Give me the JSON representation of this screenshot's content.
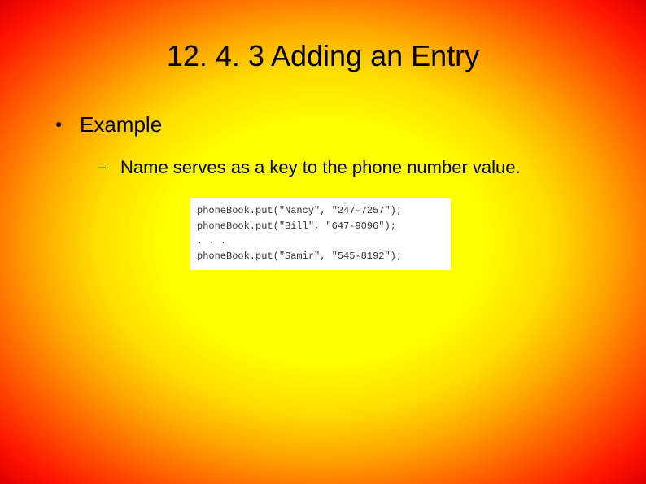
{
  "title": "12. 4. 3 Adding an Entry",
  "bullet": {
    "text": "Example",
    "sub": "Name serves as a key to the phone number value."
  },
  "code": {
    "line1": "phoneBook.put(\"Nancy\", \"247-7257\");",
    "line2": "phoneBook.put(\"Bill\", \"647-9096\");",
    "line3": ". . .",
    "line4": "phoneBook.put(\"Samir\", \"545-8192\");"
  }
}
